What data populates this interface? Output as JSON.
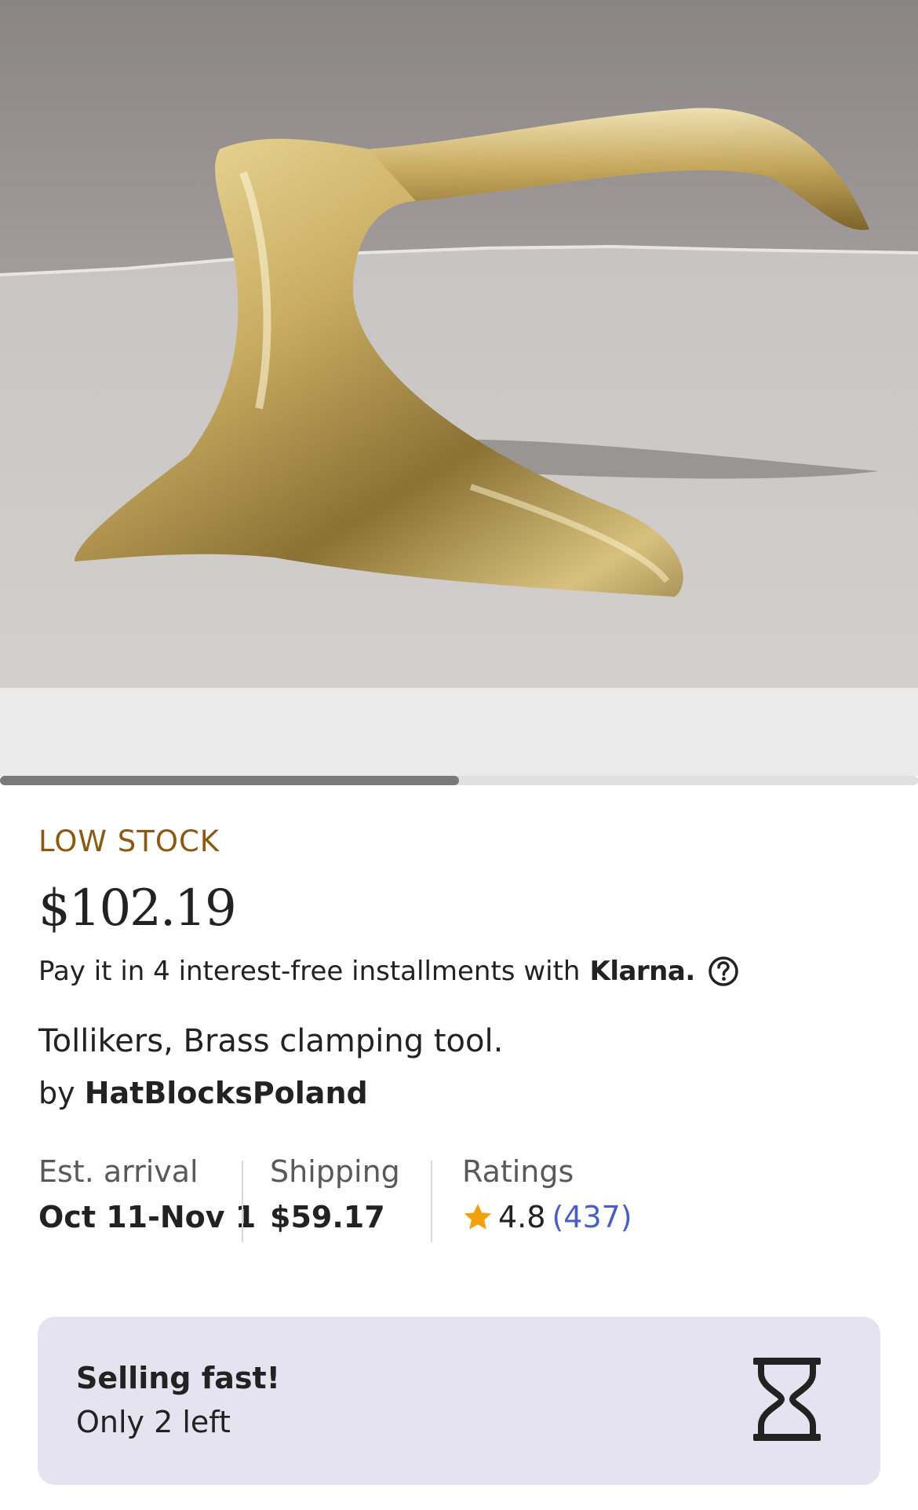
{
  "product_image": {
    "icon": "brass-tolliker-photo",
    "gallery_progress": 0.5
  },
  "product": {
    "stock_label": "LOW STOCK",
    "price": "$102.19",
    "klarna_text": "Pay it in 4 interest-free installments with",
    "klarna_brand": "Klarna.",
    "title": "Tollikers, Brass clamping tool.",
    "seller_prefix": "by",
    "seller_name": "HatBlocksPoland"
  },
  "stats": {
    "arrival_label": "Est. arrival",
    "arrival_value": "Oct 11-Nov 1",
    "shipping_label": "Shipping",
    "shipping_value": "$59.17",
    "ratings_label": "Ratings",
    "rating_value": "4.8",
    "rating_count": "(437)"
  },
  "alert": {
    "title": "Selling fast!",
    "subtitle": "Only 2 left",
    "icon": "hourglass-icon"
  },
  "colors": {
    "stock": "#8a5a12",
    "link": "#4a5fc1",
    "star": "#f1a10c",
    "alert_bg": "#e5e3ef"
  }
}
